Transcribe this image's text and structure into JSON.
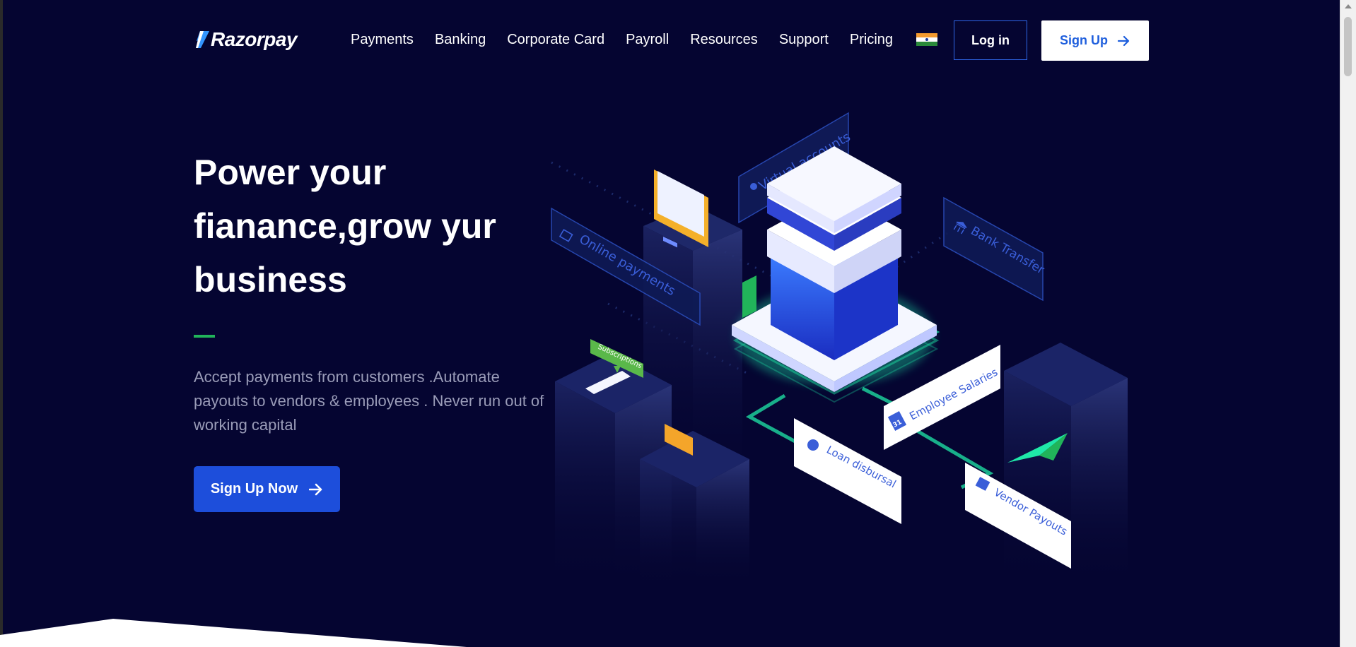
{
  "brand": {
    "name": "Razorpay"
  },
  "nav": {
    "items": [
      {
        "label": "Payments"
      },
      {
        "label": "Banking"
      },
      {
        "label": "Corporate Card"
      },
      {
        "label": "Payroll"
      },
      {
        "label": "Resources"
      },
      {
        "label": "Support"
      },
      {
        "label": "Pricing"
      }
    ],
    "flag_icon": "india-flag-icon",
    "login_label": "Log in",
    "signup_label": "Sign Up"
  },
  "hero": {
    "title": "Power your fianance,grow yur business",
    "description": "Accept payments from customers .Automate payouts to vendors & employees . Never run out of working capital",
    "cta_label": "Sign Up Now"
  },
  "illustration": {
    "labels": {
      "virtual_accounts": "Virtual accounts",
      "online_payments": "Online payments",
      "bank_transfer": "Bank Transfer",
      "subscriptions": "Subscriptions",
      "employee_salaries": "Employee Salaries",
      "loan_disbursal": "Loan disbursal",
      "vendor_payouts": "Vendor Payouts",
      "calendar_day": "31"
    }
  },
  "colors": {
    "background": "#050531",
    "primary_blue": "#1d4edb",
    "accent_green": "#21b45a",
    "glow_green": "#1fe8a8"
  }
}
